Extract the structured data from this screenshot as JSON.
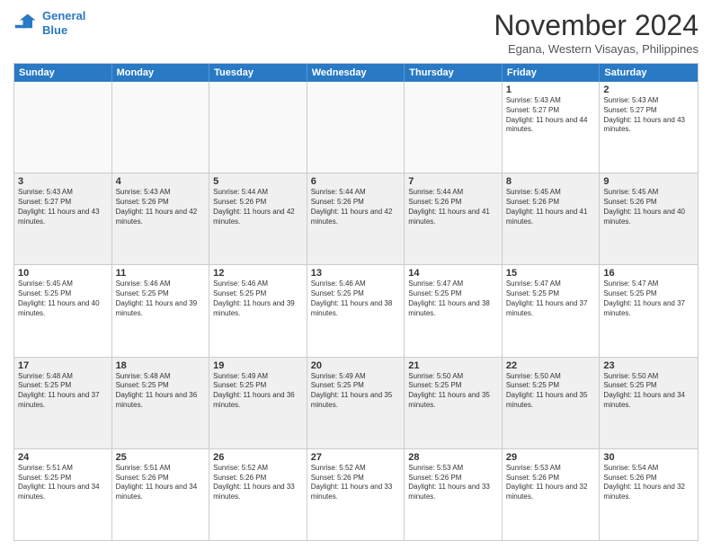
{
  "header": {
    "logo_line1": "General",
    "logo_line2": "Blue",
    "month_title": "November 2024",
    "location": "Egana, Western Visayas, Philippines"
  },
  "weekdays": [
    "Sunday",
    "Monday",
    "Tuesday",
    "Wednesday",
    "Thursday",
    "Friday",
    "Saturday"
  ],
  "rows": [
    [
      {
        "day": "",
        "empty": true
      },
      {
        "day": "",
        "empty": true
      },
      {
        "day": "",
        "empty": true
      },
      {
        "day": "",
        "empty": true
      },
      {
        "day": "",
        "empty": true
      },
      {
        "day": "1",
        "sunrise": "5:43 AM",
        "sunset": "5:27 PM",
        "daylight": "11 hours and 44 minutes."
      },
      {
        "day": "2",
        "sunrise": "5:43 AM",
        "sunset": "5:27 PM",
        "daylight": "11 hours and 43 minutes."
      }
    ],
    [
      {
        "day": "3",
        "sunrise": "5:43 AM",
        "sunset": "5:27 PM",
        "daylight": "11 hours and 43 minutes."
      },
      {
        "day": "4",
        "sunrise": "5:43 AM",
        "sunset": "5:26 PM",
        "daylight": "11 hours and 42 minutes."
      },
      {
        "day": "5",
        "sunrise": "5:44 AM",
        "sunset": "5:26 PM",
        "daylight": "11 hours and 42 minutes."
      },
      {
        "day": "6",
        "sunrise": "5:44 AM",
        "sunset": "5:26 PM",
        "daylight": "11 hours and 42 minutes."
      },
      {
        "day": "7",
        "sunrise": "5:44 AM",
        "sunset": "5:26 PM",
        "daylight": "11 hours and 41 minutes."
      },
      {
        "day": "8",
        "sunrise": "5:45 AM",
        "sunset": "5:26 PM",
        "daylight": "11 hours and 41 minutes."
      },
      {
        "day": "9",
        "sunrise": "5:45 AM",
        "sunset": "5:26 PM",
        "daylight": "11 hours and 40 minutes."
      }
    ],
    [
      {
        "day": "10",
        "sunrise": "5:45 AM",
        "sunset": "5:25 PM",
        "daylight": "11 hours and 40 minutes."
      },
      {
        "day": "11",
        "sunrise": "5:46 AM",
        "sunset": "5:25 PM",
        "daylight": "11 hours and 39 minutes."
      },
      {
        "day": "12",
        "sunrise": "5:46 AM",
        "sunset": "5:25 PM",
        "daylight": "11 hours and 39 minutes."
      },
      {
        "day": "13",
        "sunrise": "5:46 AM",
        "sunset": "5:25 PM",
        "daylight": "11 hours and 38 minutes."
      },
      {
        "day": "14",
        "sunrise": "5:47 AM",
        "sunset": "5:25 PM",
        "daylight": "11 hours and 38 minutes."
      },
      {
        "day": "15",
        "sunrise": "5:47 AM",
        "sunset": "5:25 PM",
        "daylight": "11 hours and 37 minutes."
      },
      {
        "day": "16",
        "sunrise": "5:47 AM",
        "sunset": "5:25 PM",
        "daylight": "11 hours and 37 minutes."
      }
    ],
    [
      {
        "day": "17",
        "sunrise": "5:48 AM",
        "sunset": "5:25 PM",
        "daylight": "11 hours and 37 minutes."
      },
      {
        "day": "18",
        "sunrise": "5:48 AM",
        "sunset": "5:25 PM",
        "daylight": "11 hours and 36 minutes."
      },
      {
        "day": "19",
        "sunrise": "5:49 AM",
        "sunset": "5:25 PM",
        "daylight": "11 hours and 36 minutes."
      },
      {
        "day": "20",
        "sunrise": "5:49 AM",
        "sunset": "5:25 PM",
        "daylight": "11 hours and 35 minutes."
      },
      {
        "day": "21",
        "sunrise": "5:50 AM",
        "sunset": "5:25 PM",
        "daylight": "11 hours and 35 minutes."
      },
      {
        "day": "22",
        "sunrise": "5:50 AM",
        "sunset": "5:25 PM",
        "daylight": "11 hours and 35 minutes."
      },
      {
        "day": "23",
        "sunrise": "5:50 AM",
        "sunset": "5:25 PM",
        "daylight": "11 hours and 34 minutes."
      }
    ],
    [
      {
        "day": "24",
        "sunrise": "5:51 AM",
        "sunset": "5:25 PM",
        "daylight": "11 hours and 34 minutes."
      },
      {
        "day": "25",
        "sunrise": "5:51 AM",
        "sunset": "5:26 PM",
        "daylight": "11 hours and 34 minutes."
      },
      {
        "day": "26",
        "sunrise": "5:52 AM",
        "sunset": "5:26 PM",
        "daylight": "11 hours and 33 minutes."
      },
      {
        "day": "27",
        "sunrise": "5:52 AM",
        "sunset": "5:26 PM",
        "daylight": "11 hours and 33 minutes."
      },
      {
        "day": "28",
        "sunrise": "5:53 AM",
        "sunset": "5:26 PM",
        "daylight": "11 hours and 33 minutes."
      },
      {
        "day": "29",
        "sunrise": "5:53 AM",
        "sunset": "5:26 PM",
        "daylight": "11 hours and 32 minutes."
      },
      {
        "day": "30",
        "sunrise": "5:54 AM",
        "sunset": "5:26 PM",
        "daylight": "11 hours and 32 minutes."
      }
    ]
  ]
}
